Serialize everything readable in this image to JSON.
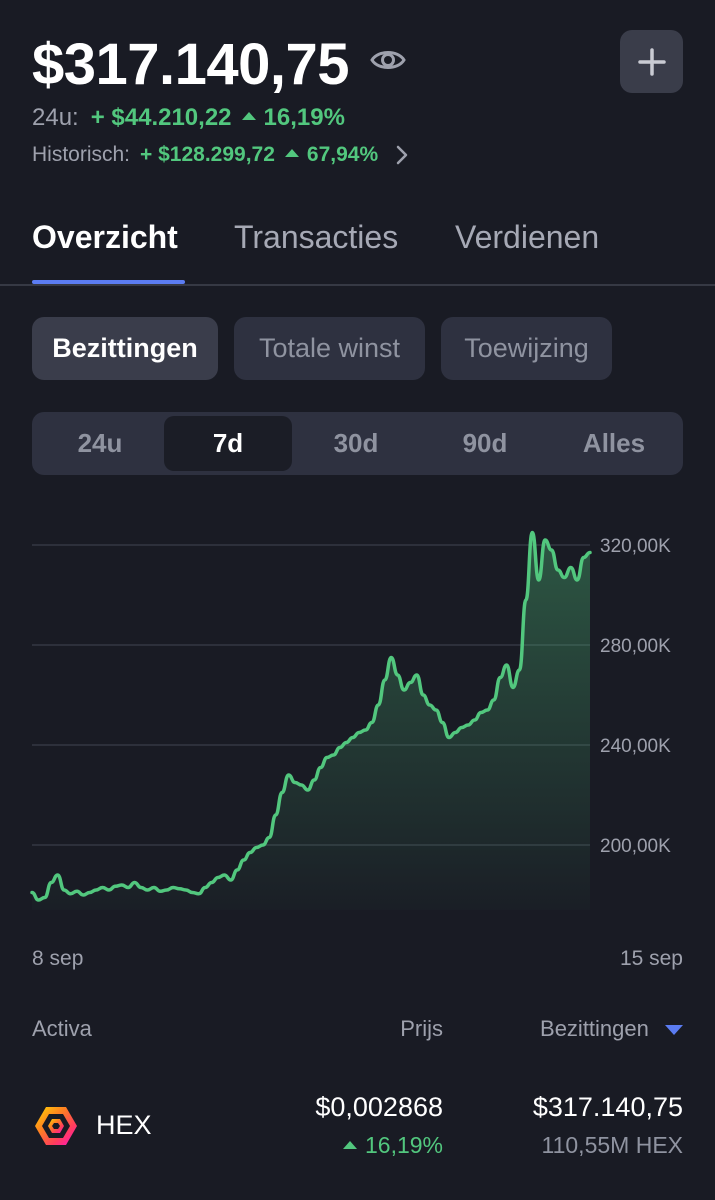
{
  "header": {
    "balance": "$317.140,75",
    "day_label": "24u:",
    "day_change_value": "+ $44.210,22",
    "day_change_pct": "16,19%",
    "historic_label": "Historisch:",
    "historic_change_value": "+ $128.299,72",
    "historic_change_pct": "67,94%"
  },
  "tabs": [
    {
      "label": "Overzicht",
      "active": true
    },
    {
      "label": "Transacties",
      "active": false
    },
    {
      "label": "Verdienen",
      "active": false
    }
  ],
  "filters": [
    {
      "label": "Bezittingen",
      "active": true
    },
    {
      "label": "Totale winst",
      "active": false
    },
    {
      "label": "Toewijzing",
      "active": false
    }
  ],
  "periods": [
    {
      "label": "24u",
      "active": false
    },
    {
      "label": "7d",
      "active": true
    },
    {
      "label": "30d",
      "active": false
    },
    {
      "label": "90d",
      "active": false
    },
    {
      "label": "Alles",
      "active": false
    }
  ],
  "colors": {
    "background": "#191b24",
    "positive": "#52c77e",
    "accent": "#5b7cf2",
    "muted": "#9ea1ad"
  },
  "chart_data": {
    "type": "area",
    "ylim": [
      174000,
      330000
    ],
    "y_ticks": [
      {
        "value": 200000,
        "label": "200,00K"
      },
      {
        "value": 240000,
        "label": "240,00K"
      },
      {
        "value": 280000,
        "label": "280,00K"
      },
      {
        "value": 320000,
        "label": "320,00K"
      }
    ],
    "x_start_label": "8 sep",
    "x_end_label": "15 sep",
    "grid": true,
    "series": [
      {
        "values": [
          181000,
          178000,
          179000,
          185000,
          188000,
          182000,
          180500,
          181500,
          180000,
          181000,
          182000,
          183000,
          182000,
          183500,
          184000,
          183000,
          185000,
          183000,
          182000,
          183000,
          181500,
          182000,
          183000,
          182500,
          182000,
          181000,
          180500,
          183000,
          185000,
          187000,
          188000,
          186000,
          190000,
          194000,
          197000,
          199000,
          200000,
          203000,
          212000,
          221000,
          228000,
          225000,
          224000,
          222000,
          226000,
          231000,
          235000,
          236000,
          239000,
          241000,
          243000,
          245000,
          246000,
          249000,
          256000,
          266000,
          275000,
          268000,
          262000,
          265000,
          268000,
          260000,
          256000,
          254000,
          249000,
          243000,
          245000,
          247000,
          248000,
          250000,
          253000,
          254000,
          258000,
          267000,
          272000,
          263000,
          270000,
          298000,
          325000,
          306000,
          322000,
          318000,
          310000,
          307000,
          311000,
          306000,
          315000,
          317000
        ]
      }
    ]
  },
  "table": {
    "col_asset": "Activa",
    "col_price": "Prijs",
    "col_holdings": "Bezittingen",
    "rows": [
      {
        "name": "HEX",
        "price": "$0,002868",
        "change": "16,19%",
        "holding_value": "$317.140,75",
        "holding_amount": "110,55M HEX"
      }
    ]
  },
  "icons": {
    "visibility": "eye-icon",
    "add": "plus-icon",
    "navigate": "chevron-right-icon",
    "sort": "sort-down-icon",
    "asset": "hex-logo-icon"
  }
}
